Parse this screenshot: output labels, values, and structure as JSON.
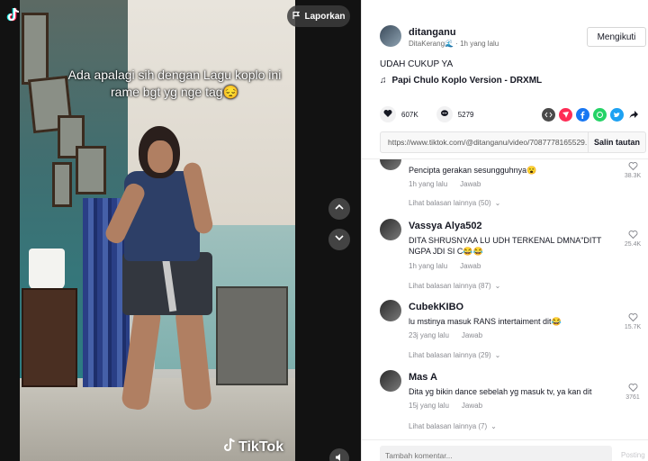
{
  "video": {
    "caption": "Ada apalagi sih dengan Lagu koplo ini rame bgt yg nge tag😔",
    "report_label": "Laporkan",
    "watermark_label": "TikTok"
  },
  "post": {
    "username": "ditanganu",
    "display_name": "DitaKerang🌊",
    "time_ago": "1h yang lalu",
    "follow_label": "Mengikuti",
    "description": "UDAH CUKUP YA",
    "music": "Papi Chulo Koplo Version - DRXML",
    "likes": "607K",
    "comments_count": "5279",
    "link_url": "https://www.tiktok.com/@ditanganu/video/7087778165529...",
    "copy_link_label": "Salin tautan"
  },
  "comments": [
    {
      "name": "",
      "text": "Pencipta gerakan sesungguhnya😮",
      "time": "1h yang lalu",
      "reply": "Jawab",
      "likes": "38.3K",
      "more": "Lihat balasan lainnya (50)"
    },
    {
      "name": "Vassya Alya502",
      "text": "DITA SHRUSNYAA LU UDH TERKENAL DMNA\"DITT NGPA JDI SI C😂😂",
      "time": "1h yang lalu",
      "reply": "Jawab",
      "likes": "25.4K",
      "more": "Lihat balasan lainnya (87)"
    },
    {
      "name": "CubekKIBO",
      "text": "lu mstinya masuk RANS intertaiment dit😂",
      "time": "23j yang lalu",
      "reply": "Jawab",
      "likes": "15.7K",
      "more": "Lihat balasan lainnya (29)"
    },
    {
      "name": "Mas A",
      "text": "Dita yg bikin dance sebelah yg masuk tv, ya kan dit",
      "time": "15j yang lalu",
      "reply": "Jawab",
      "likes": "3761",
      "more": "Lihat balasan lainnya (7)"
    }
  ],
  "comment_input": {
    "placeholder": "Tambah komentar...",
    "post_label": "Posting"
  },
  "colors": {
    "tiktok_red": "#fe2c55",
    "tiktok_cyan": "#25f4ee",
    "facebook": "#1877f2",
    "whatsapp": "#25d366",
    "twitter": "#1da1f2"
  }
}
